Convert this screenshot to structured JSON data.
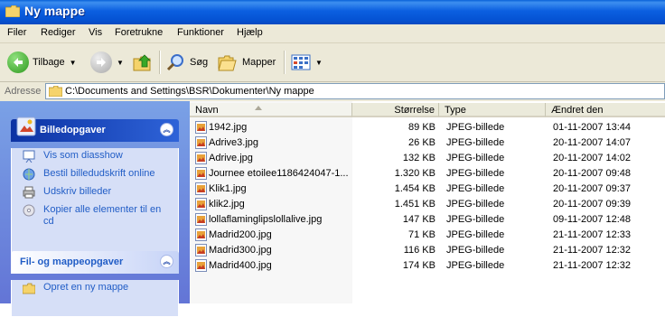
{
  "window": {
    "title": "Ny mappe"
  },
  "menu": [
    "Filer",
    "Rediger",
    "Vis",
    "Foretrukne",
    "Funktioner",
    "Hjælp"
  ],
  "toolbar": {
    "back_label": "Tilbage",
    "search_label": "Søg",
    "folders_label": "Mapper"
  },
  "address": {
    "label": "Adresse",
    "path": "C:\\Documents and Settings\\BSR\\Dokumenter\\Ny mappe"
  },
  "tasks": {
    "picture": {
      "title": "Billedopgaver",
      "items": [
        "Vis som diasshow",
        "Bestil billedudskrift online",
        "Udskriv billeder",
        "Kopier alle elementer til en cd"
      ]
    },
    "file": {
      "title": "Fil- og mappeopgaver",
      "items": [
        "Opret en ny mappe"
      ]
    }
  },
  "columns": {
    "name": "Navn",
    "size": "Størrelse",
    "type": "Type",
    "date": "Ændret den"
  },
  "files": [
    {
      "name": "1942.jpg",
      "size": "89 KB",
      "type": "JPEG-billede",
      "date": "01-11-2007 13:44"
    },
    {
      "name": "Adrive3.jpg",
      "size": "26 KB",
      "type": "JPEG-billede",
      "date": "20-11-2007 14:07"
    },
    {
      "name": "Adrive.jpg",
      "size": "132 KB",
      "type": "JPEG-billede",
      "date": "20-11-2007 14:02"
    },
    {
      "name": "Journee etoilee1186424047-1...",
      "size": "1.320 KB",
      "type": "JPEG-billede",
      "date": "20-11-2007 09:48"
    },
    {
      "name": "Klik1.jpg",
      "size": "1.454 KB",
      "type": "JPEG-billede",
      "date": "20-11-2007 09:37"
    },
    {
      "name": "klik2.jpg",
      "size": "1.451 KB",
      "type": "JPEG-billede",
      "date": "20-11-2007 09:39"
    },
    {
      "name": "lollaflaminglipslollalive.jpg",
      "size": "147 KB",
      "type": "JPEG-billede",
      "date": "09-11-2007 12:48"
    },
    {
      "name": "Madrid200.jpg",
      "size": "71 KB",
      "type": "JPEG-billede",
      "date": "21-11-2007 12:33"
    },
    {
      "name": "Madrid300.jpg",
      "size": "116 KB",
      "type": "JPEG-billede",
      "date": "21-11-2007 12:32"
    },
    {
      "name": "Madrid400.jpg",
      "size": "174 KB",
      "type": "JPEG-billede",
      "date": "21-11-2007 12:32"
    }
  ]
}
